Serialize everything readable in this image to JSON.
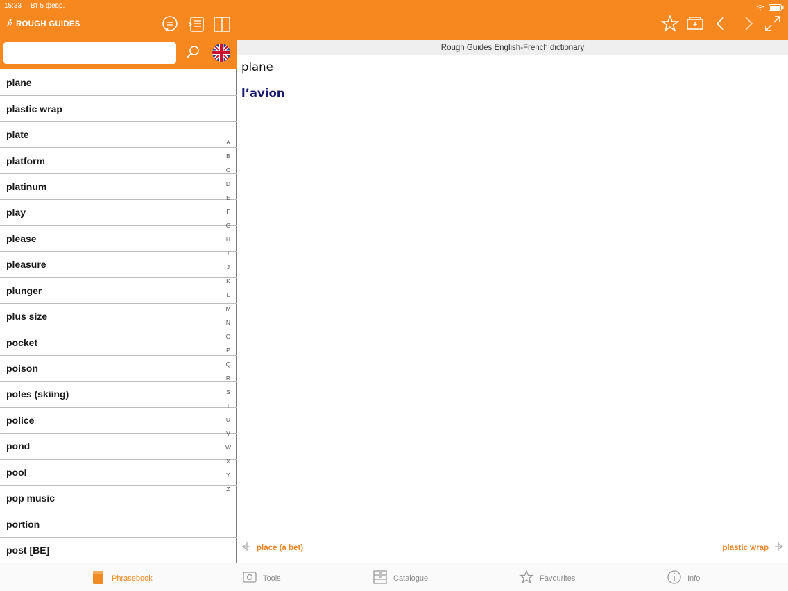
{
  "status": {
    "time": "15:33",
    "date": "Вт 5 февр."
  },
  "brand": {
    "name": "ROUGH GUIDES"
  },
  "search": {
    "value": "",
    "placeholder": ""
  },
  "words": [
    "plane",
    "plastic wrap",
    "plate",
    "platform",
    "platinum",
    "play",
    "please",
    "pleasure",
    "plunger",
    "plus size",
    "pocket",
    "poison",
    "poles (skiing)",
    "police",
    "pond",
    "pool",
    "pop music",
    "portion",
    "post [BE]"
  ],
  "alphabet": [
    "A",
    "B",
    "C",
    "D",
    "E",
    "F",
    "G",
    "H",
    "I",
    "J",
    "K",
    "L",
    "M",
    "N",
    "O",
    "P",
    "Q",
    "R",
    "S",
    "T",
    "U",
    "V",
    "W",
    "X",
    "Y",
    "Z"
  ],
  "dictionary": {
    "title": "Rough Guides English-French dictionary"
  },
  "entry": {
    "headword": "plane",
    "translation": "l’avion"
  },
  "navigation": {
    "previous": "place (a bet)",
    "next": "plastic wrap"
  },
  "tabs": [
    {
      "label": "Phrasebook",
      "icon": "phrasebook-icon",
      "active": true
    },
    {
      "label": "Tools",
      "icon": "tools-icon",
      "active": false
    },
    {
      "label": "Catalogue",
      "icon": "catalogue-icon",
      "active": false
    },
    {
      "label": "Favourites",
      "icon": "star-icon",
      "active": false
    },
    {
      "label": "Info",
      "icon": "info-icon",
      "active": false
    }
  ],
  "colors": {
    "accent": "#f6881f",
    "translation": "#1b1b6e",
    "link": "#e8862a"
  }
}
